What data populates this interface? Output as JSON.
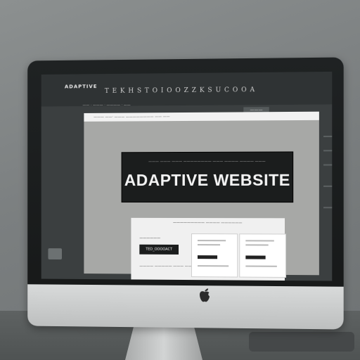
{
  "screen": {
    "brand": "ADAPTIVE",
    "brand_sub": "T E K H S T O  I O O Z Z  K S U  C O O A",
    "nav": "—— ·  ——— ·  ———— ·  ——",
    "nav_button": "———"
  },
  "page": {
    "url_bar": "——— ——· ——— ———————— —— ——",
    "hero": {
      "kicker": "——— ——— ——— ———————— ——— ———— ———— ———",
      "title": "ADAPTIVE WEBSITE"
    },
    "cards": {
      "heading": "————————— ———— ——————",
      "left_label": "——————",
      "left_button": "TED_OOOOACT",
      "left_text": "———— ————— ——— ———"
    }
  },
  "colors": {
    "hero_bg": "#1b1d1d",
    "hero_text": "#f4f4f4",
    "page_bg": "#a7a8a6",
    "screen_bg": "#3b3f40"
  }
}
